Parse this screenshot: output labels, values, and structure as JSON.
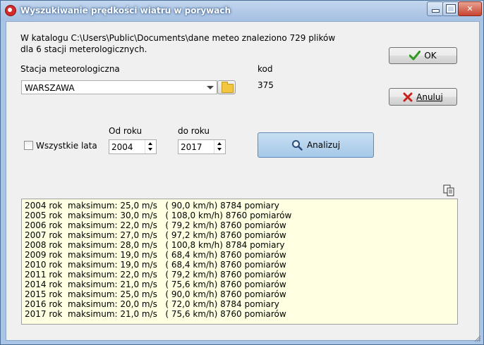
{
  "window": {
    "title": "Wyszukiwanie prędkości wiatru w porywach",
    "controls": {
      "minimize": "minimize",
      "maximize": "maximize",
      "close": "close"
    }
  },
  "info": {
    "line1": "W katalogu C:\\Users\\Public\\Documents\\dane meteo znaleziono 729 plików",
    "line2": "dla 6 stacji meterologicznych."
  },
  "station": {
    "label": "Stacja meteorologiczna",
    "selected": "WARSZAWA",
    "code_label": "kod",
    "code_value": "375"
  },
  "buttons": {
    "ok": "OK",
    "cancel": "Anuluj",
    "analyze": "Analizuj"
  },
  "years": {
    "all_label": "Wszystkie lata",
    "all_checked": false,
    "from_label": "Od roku",
    "from_value": "2004",
    "to_label": "do roku",
    "to_value": "2017"
  },
  "results": [
    "2004 rok  maksimum: 25,0 m/s   ( 90,0 km/h) 8784 pomiary",
    "2005 rok  maksimum: 30,0 m/s   ( 108,0 km/h) 8760 pomiarów",
    "2006 rok  maksimum: 22,0 m/s   ( 79,2 km/h) 8760 pomiarów",
    "2007 rok  maksimum: 27,0 m/s   ( 97,2 km/h) 8760 pomiarów",
    "2008 rok  maksimum: 28,0 m/s   ( 100,8 km/h) 8784 pomiary",
    "2009 rok  maksimum: 19,0 m/s   ( 68,4 km/h) 8760 pomiarów",
    "2010 rok  maksimum: 19,0 m/s   ( 68,4 km/h) 8760 pomiarów",
    "2011 rok  maksimum: 22,0 m/s   ( 79,2 km/h) 8760 pomiarów",
    "2014 rok  maksimum: 21,0 m/s   ( 75,6 km/h) 8760 pomiarów",
    "2015 rok  maksimum: 25,0 m/s   ( 90,0 km/h) 8760 pomiarów",
    "2016 rok  maksimum: 20,0 m/s   ( 72,0 km/h) 8784 pomiary",
    "2017 rok  maksimum: 21,0 m/s   ( 75,6 km/h) 8760 pomiarów"
  ],
  "colors": {
    "titlebar": "#a9c4e4",
    "results_bg": "#ffffe1",
    "ok_check": "#2e9a1e",
    "cancel_x": "#c8201a"
  },
  "icons": [
    "app-icon",
    "folder-icon",
    "check-icon",
    "x-icon",
    "magnifier-icon",
    "copy-icon"
  ]
}
